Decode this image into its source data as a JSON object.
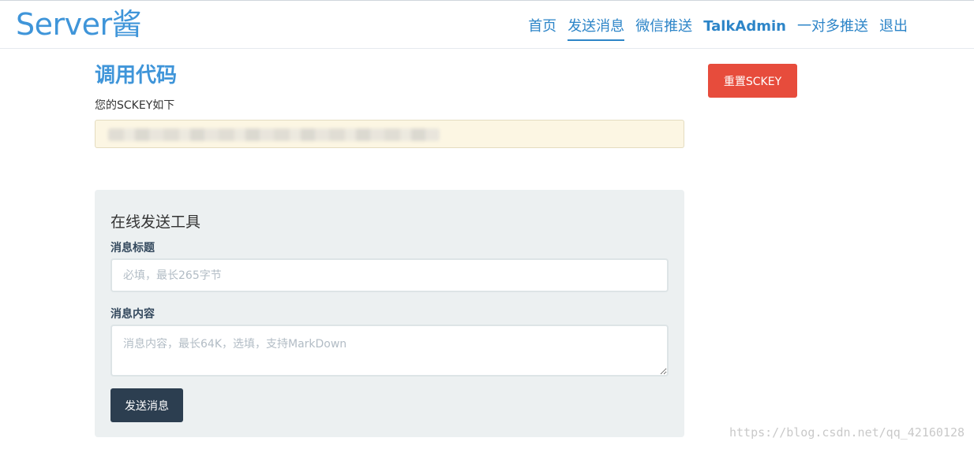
{
  "header": {
    "brand": "Server酱",
    "nav": [
      {
        "label": "首页"
      },
      {
        "label": "发送消息"
      },
      {
        "label": "微信推送"
      },
      {
        "label": "TalkAdmin"
      },
      {
        "label": "一对多推送"
      },
      {
        "label": "退出"
      }
    ],
    "active_nav": "发送消息"
  },
  "main": {
    "title": "调用代码",
    "subtitle": "您的SCKEY如下",
    "reset_button": "重置SCKEY"
  },
  "tool": {
    "title": "在线发送工具",
    "message_title_label": "消息标题",
    "message_title_placeholder": "必填，最长265字节",
    "message_title_value": "",
    "message_content_label": "消息内容",
    "message_content_placeholder": "消息内容，最长64K，选填，支持MarkDown",
    "message_content_value": "",
    "send_button": "发送消息"
  },
  "watermark": "https://blog.csdn.net/qq_42160128",
  "colors": {
    "brand": "#3f95d9",
    "nav_link": "#2d85c8",
    "reset_button": "#e74c3c",
    "send_button": "#2c3e50",
    "panel_bg": "#ecf0f1",
    "key_box_bg": "#fcf6e3"
  }
}
